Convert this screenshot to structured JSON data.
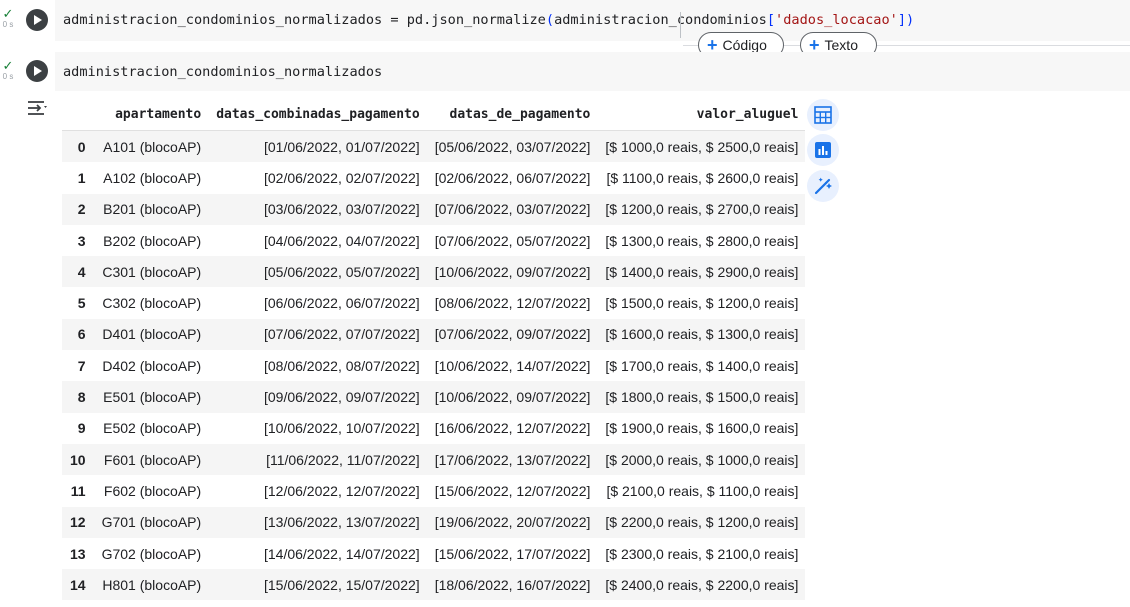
{
  "cell1": {
    "status_time": "0 s",
    "code_var": "administracion_condominios_normalizados",
    "code_op": " = pd.json_normalize",
    "code_open": "(",
    "code_arg": "administracion_condominios",
    "code_br_open": "[",
    "code_str": "'dados_locacao'",
    "code_br_close": "]",
    "code_close": ")"
  },
  "cell2": {
    "status_time": "0 s",
    "code": "administracion_condominios_normalizados"
  },
  "add_cell": {
    "code_label": "Código",
    "text_label": "Texto"
  },
  "table": {
    "headers": [
      "",
      "apartamento",
      "datas_combinadas_pagamento",
      "datas_de_pagamento",
      "valor_aluguel"
    ],
    "rows": [
      [
        "0",
        "A101 (blocoAP)",
        "[01/06/2022, 01/07/2022]",
        "[05/06/2022, 03/07/2022]",
        "[$ 1000,0 reais, $ 2500,0 reais]"
      ],
      [
        "1",
        "A102 (blocoAP)",
        "[02/06/2022, 02/07/2022]",
        "[02/06/2022, 06/07/2022]",
        "[$ 1100,0 reais, $ 2600,0 reais]"
      ],
      [
        "2",
        "B201 (blocoAP)",
        "[03/06/2022, 03/07/2022]",
        "[07/06/2022, 03/07/2022]",
        "[$ 1200,0 reais, $ 2700,0 reais]"
      ],
      [
        "3",
        "B202 (blocoAP)",
        "[04/06/2022, 04/07/2022]",
        "[07/06/2022, 05/07/2022]",
        "[$ 1300,0 reais, $ 2800,0 reais]"
      ],
      [
        "4",
        "C301 (blocoAP)",
        "[05/06/2022, 05/07/2022]",
        "[10/06/2022, 09/07/2022]",
        "[$ 1400,0 reais, $ 2900,0 reais]"
      ],
      [
        "5",
        "C302 (blocoAP)",
        "[06/06/2022, 06/07/2022]",
        "[08/06/2022, 12/07/2022]",
        "[$ 1500,0 reais, $ 1200,0 reais]"
      ],
      [
        "6",
        "D401 (blocoAP)",
        "[07/06/2022, 07/07/2022]",
        "[07/06/2022, 09/07/2022]",
        "[$ 1600,0 reais, $ 1300,0 reais]"
      ],
      [
        "7",
        "D402 (blocoAP)",
        "[08/06/2022, 08/07/2022]",
        "[10/06/2022, 14/07/2022]",
        "[$ 1700,0 reais, $ 1400,0 reais]"
      ],
      [
        "8",
        "E501 (blocoAP)",
        "[09/06/2022, 09/07/2022]",
        "[10/06/2022, 09/07/2022]",
        "[$ 1800,0 reais, $ 1500,0 reais]"
      ],
      [
        "9",
        "E502 (blocoAP)",
        "[10/06/2022, 10/07/2022]",
        "[16/06/2022, 12/07/2022]",
        "[$ 1900,0 reais, $ 1600,0 reais]"
      ],
      [
        "10",
        "F601 (blocoAP)",
        "[11/06/2022, 11/07/2022]",
        "[17/06/2022, 13/07/2022]",
        "[$ 2000,0 reais, $ 1000,0 reais]"
      ],
      [
        "11",
        "F602 (blocoAP)",
        "[12/06/2022, 12/07/2022]",
        "[15/06/2022, 12/07/2022]",
        "[$ 2100,0 reais, $ 1100,0 reais]"
      ],
      [
        "12",
        "G701 (blocoAP)",
        "[13/06/2022, 13/07/2022]",
        "[19/06/2022, 20/07/2022]",
        "[$ 2200,0 reais, $ 1200,0 reais]"
      ],
      [
        "13",
        "G702 (blocoAP)",
        "[14/06/2022, 14/07/2022]",
        "[15/06/2022, 17/07/2022]",
        "[$ 2300,0 reais, $ 2100,0 reais]"
      ],
      [
        "14",
        "H801 (blocoAP)",
        "[15/06/2022, 15/07/2022]",
        "[18/06/2022, 16/07/2022]",
        "[$ 2400,0 reais, $ 2200,0 reais]"
      ]
    ]
  },
  "side_buttons": [
    "table-icon",
    "chart-icon",
    "magic-wand-icon"
  ],
  "colors": {
    "accent": "#1a73e8",
    "check": "#188038",
    "string": "#a31515"
  }
}
